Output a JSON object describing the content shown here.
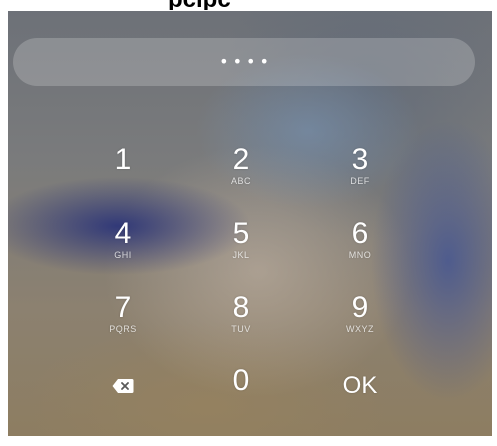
{
  "header": {
    "cropped_title": "pcipc"
  },
  "pin_field": {
    "masked_value": "••••"
  },
  "keypad": {
    "keys": [
      {
        "digit": "1",
        "letters": ""
      },
      {
        "digit": "2",
        "letters": "ABC"
      },
      {
        "digit": "3",
        "letters": "DEF"
      },
      {
        "digit": "4",
        "letters": "GHI"
      },
      {
        "digit": "5",
        "letters": "JKL"
      },
      {
        "digit": "6",
        "letters": "MNO"
      },
      {
        "digit": "7",
        "letters": "PQRS"
      },
      {
        "digit": "8",
        "letters": "TUV"
      },
      {
        "digit": "9",
        "letters": "WXYZ"
      },
      {
        "digit": "0",
        "letters": ""
      }
    ],
    "backspace_icon": "backspace-icon",
    "ok_label": "OK"
  }
}
